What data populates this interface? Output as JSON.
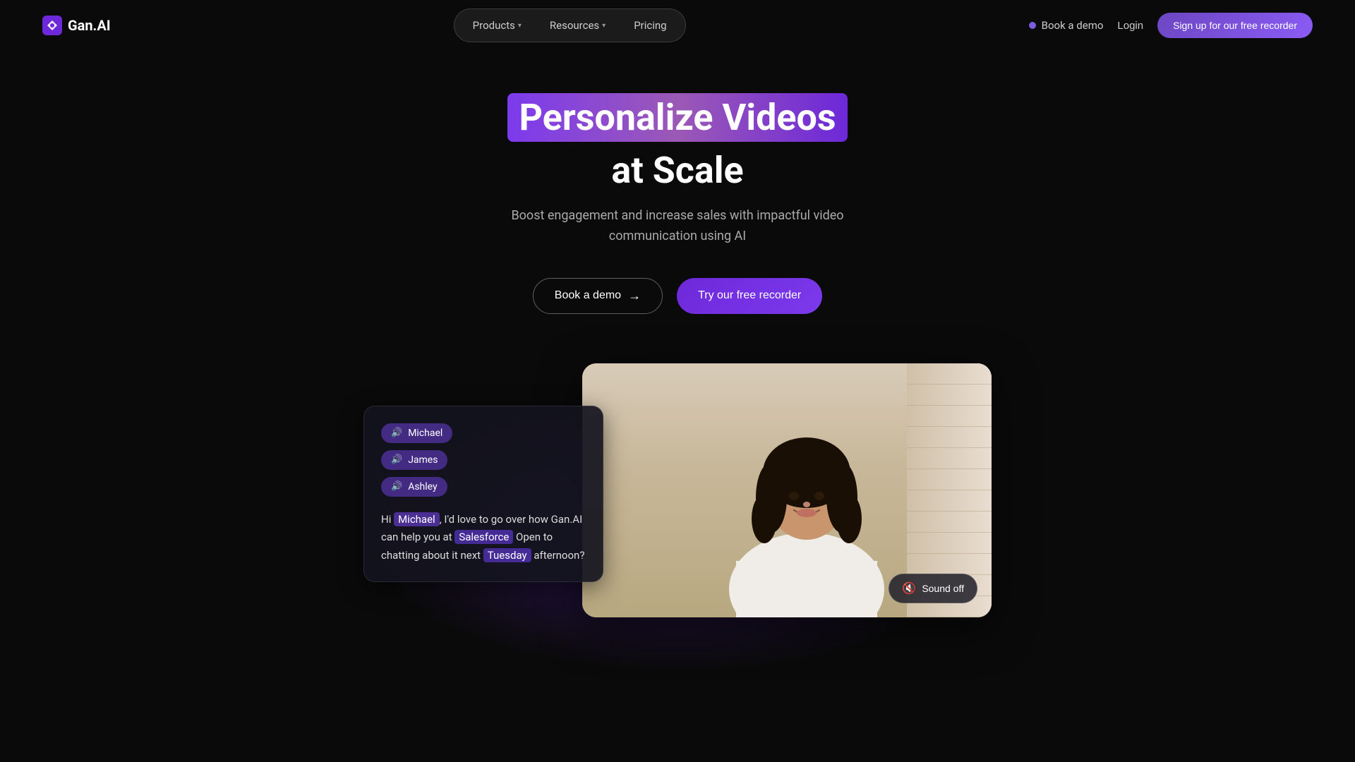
{
  "nav": {
    "logo_text": "Gan.AI",
    "items": [
      {
        "label": "Products",
        "has_dropdown": true
      },
      {
        "label": "Resources",
        "has_dropdown": true
      },
      {
        "label": "Pricing",
        "has_dropdown": false
      }
    ],
    "book_demo": "Book a demo",
    "login": "Login",
    "signup": "Sign up for our free recorder"
  },
  "hero": {
    "title_highlight": "Personalize Videos",
    "title_main": "at Scale",
    "subtitle_line1": "Boost engagement and increase sales with impactful video",
    "subtitle_line2": "communication using AI",
    "btn_demo": "Book a demo",
    "btn_recorder": "Try our free recorder"
  },
  "persona_card": {
    "people": [
      {
        "name": "Michael"
      },
      {
        "name": "James"
      },
      {
        "name": "Ashley"
      }
    ],
    "greeting": "Hi ",
    "name_highlight": "Michael",
    "text_mid": ", I'd love to go over how Gan.AI can help you at ",
    "company_highlight": "Salesforce",
    "text_after": " Open to chatting about it next ",
    "day_highlight": "Tuesday",
    "text_end": " afternoon?"
  },
  "video": {
    "sound_off_label": "Sound off"
  },
  "colors": {
    "accent_purple": "#7c3aed",
    "accent_purple_light": "#8b5cf6",
    "persona_bg": "rgba(100,60,200,0.6)",
    "nav_bg": "rgba(255,255,255,0.07)"
  }
}
